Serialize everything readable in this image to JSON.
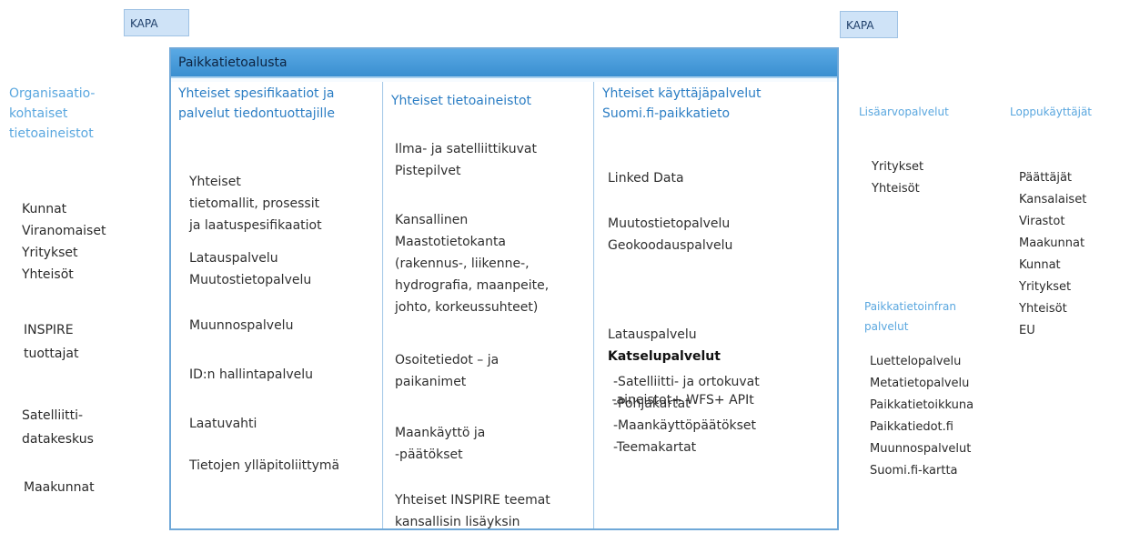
{
  "kapa_left": "KAPA",
  "kapa_right": "KAPA",
  "left": {
    "heading": [
      "Organisaatio-",
      "kohtaiset",
      "tietoaineistot"
    ],
    "group1": [
      "Kunnat",
      "Viranomaiset",
      "Yritykset",
      "Yhteisöt"
    ],
    "group2": [
      "INSPIRE",
      "tuottajat"
    ],
    "group3": [
      "Satelliitti-",
      "datakeskus"
    ],
    "group4": [
      "Maakunnat"
    ]
  },
  "platform": {
    "title": "Paikkatietoalusta",
    "col1": {
      "heading": [
        "Yhteiset spesifikaatiot ja",
        "palvelut tiedontuottajille"
      ],
      "items": [
        [
          "Yhteiset",
          "tietomallit, prosessit",
          "ja laatuspesifikaatiot"
        ],
        [
          "Latauspalvelu",
          "Muutostietopalvelu"
        ],
        [
          "Muunnospalvelu"
        ],
        [
          "ID:n hallintapalvelu"
        ],
        [
          "Laatuvahti"
        ],
        [
          "Tietojen ylläpitoliittymä"
        ]
      ]
    },
    "col2": {
      "heading": [
        "Yhteiset tietoaineistot"
      ],
      "items": [
        [
          "Ilma- ja satelliittikuvat",
          "Pistepilvet"
        ],
        [
          "Kansallinen",
          "Maastotietokanta",
          "(rakennus-, liikenne-,",
          "hydrografia, maanpeite,",
          "johto, korkeussuhteet)"
        ],
        [
          "Osoitetiedot – ja",
          "paikanimet"
        ],
        [
          "Maankäyttö ja",
          "-päätökset"
        ],
        [
          "Yhteiset INSPIRE teemat",
          "kansallisin lisäyksin"
        ]
      ]
    },
    "col3": {
      "heading": [
        "Yhteiset käyttäjäpalvelut",
        "Suomi.fi-paikkatieto"
      ],
      "items": [
        [
          "Linked Data"
        ],
        [
          "Muutostietopalvelu",
          "Geokoodauspalvelu"
        ],
        [
          "Latauspalvelu",
          " -aineistot+ WFS+ APIt"
        ]
      ],
      "katselu_heading": "Katselupalvelut",
      "katselu_items": [
        "-Satelliitti- ja ortokuvat",
        "-Pohjakartat",
        "-Maankäyttöpäätökset",
        "-Teemakartat"
      ]
    }
  },
  "right": {
    "lisaarvo_heading": "Lisäarvopalvelut",
    "lisaarvo_items": [
      "Yritykset",
      "Yhteisöt"
    ],
    "loppu_heading": "Loppukäyttäjät",
    "loppu_items": [
      "Päättäjät",
      "Kansalaiset",
      "Virastot",
      "Maakunnat",
      "Kunnat",
      "Yritykset",
      "Yhteisöt",
      "EU"
    ],
    "infra_heading": [
      "Paikkatietoinfran",
      "palvelut"
    ],
    "infra_items": [
      "Luettelopalvelu",
      "Metatietopalvelu",
      "Paikkatietoikkuna",
      "Paikkatiedot.fi",
      "Muunnospalvelut",
      "Suomi.fi-kartta"
    ]
  }
}
